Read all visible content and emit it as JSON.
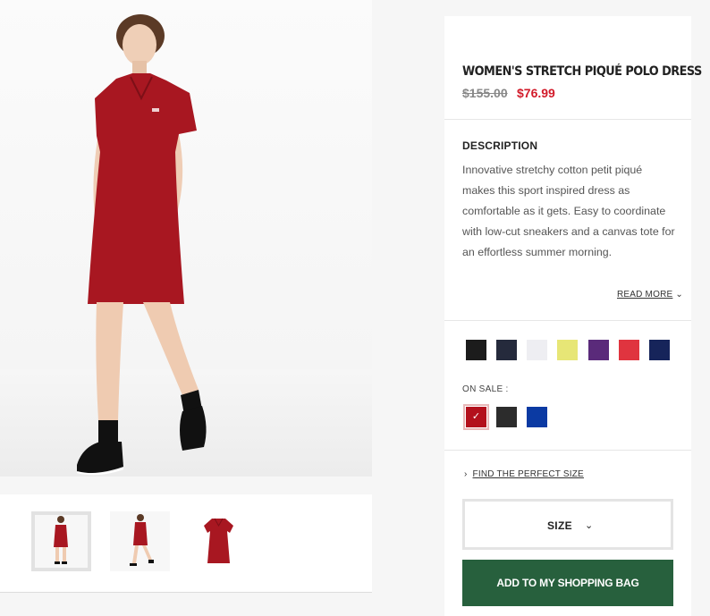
{
  "product": {
    "title": "WOMEN'S STRETCH PIQUÉ POLO DRESS",
    "price_original": "$155.00",
    "price_sale": "$76.99"
  },
  "description": {
    "heading": "DESCRIPTION",
    "text": "Innovative stretchy cotton petit piqué makes this sport inspired dress as comfortable as it gets. Easy to coordinate with low-cut sneakers and a canvas tote for an effortless summer morning.",
    "read_more": "READ MORE"
  },
  "colors": {
    "swatches": [
      "#1c1c1c",
      "#252a3c",
      "#eeeef2",
      "#e7e676",
      "#5a2a7a",
      "#e0343f",
      "#16245a"
    ],
    "on_sale_label": "ON SALE :",
    "sale_swatches": [
      "#b3101c",
      "#2c2c2c",
      "#0b3aa3"
    ],
    "selected_sale_index": 0
  },
  "size": {
    "find_size_label": "FIND THE PERFECT SIZE",
    "size_button_label": "SIZE"
  },
  "cart": {
    "add_button_label": "ADD TO MY SHOPPING BAG"
  },
  "icons": {
    "chevron": "chevron-down-icon",
    "arrow": "chevron-right-icon",
    "check": "check-icon"
  },
  "thumbnails": [
    "front view",
    "walking view",
    "dress only"
  ],
  "accent_colors": {
    "sale_red": "#d21b2a",
    "cart_green": "#27603d"
  }
}
